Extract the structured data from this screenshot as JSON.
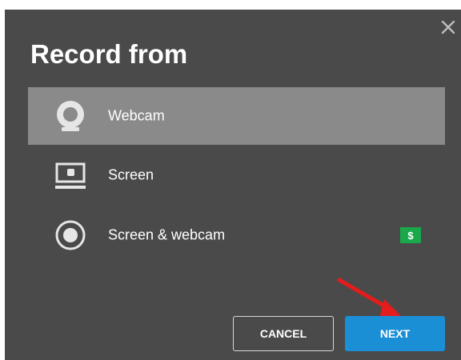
{
  "dialog": {
    "title": "Record from",
    "close_icon": "close-icon",
    "options": [
      {
        "label": "Webcam",
        "icon": "webcam-icon",
        "selected": true
      },
      {
        "label": "Screen",
        "icon": "screen-icon",
        "selected": false
      },
      {
        "label": "Screen & webcam",
        "icon": "screen-webcam-icon",
        "selected": false,
        "badge": "$"
      }
    ],
    "buttons": {
      "cancel_label": "CANCEL",
      "next_label": "NEXT"
    },
    "annotation": "red-arrow-icon"
  },
  "colors": {
    "dialog_bg": "#4a4a4a",
    "selected_bg": "#8a8a8a",
    "next_bg": "#1a8fd6",
    "badge_bg": "#19a84a",
    "arrow": "#e51c1c"
  }
}
